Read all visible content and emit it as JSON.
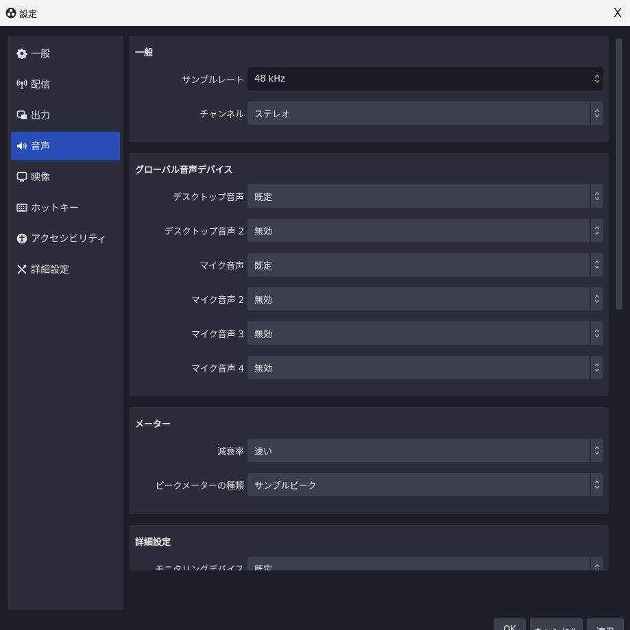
{
  "window": {
    "title": "設定",
    "close_symbol": "X"
  },
  "sidebar": {
    "items": [
      {
        "label": "一般",
        "icon": "gear-icon"
      },
      {
        "label": "配信",
        "icon": "antenna-icon"
      },
      {
        "label": "出力",
        "icon": "output-icon"
      },
      {
        "label": "音声",
        "icon": "speaker-icon",
        "active": true
      },
      {
        "label": "映像",
        "icon": "monitor-icon"
      },
      {
        "label": "ホットキー",
        "icon": "keyboard-icon"
      },
      {
        "label": "アクセシビリティ",
        "icon": "accessibility-icon"
      },
      {
        "label": "詳細設定",
        "icon": "tools-icon"
      }
    ]
  },
  "general": {
    "title": "一般",
    "sample_rate": {
      "label": "サンプルレート",
      "value": "48 kHz"
    },
    "channel": {
      "label": "チャンネル",
      "value": "ステレオ"
    }
  },
  "global_devices": {
    "title": "グローバル音声デバイス",
    "rows": [
      {
        "label": "デスクトップ音声",
        "value": "既定"
      },
      {
        "label": "デスクトップ音声 2",
        "value": "無効"
      },
      {
        "label": "マイク音声",
        "value": "既定"
      },
      {
        "label": "マイク音声 2",
        "value": "無効"
      },
      {
        "label": "マイク音声 3",
        "value": "無効"
      },
      {
        "label": "マイク音声 4",
        "value": "無効"
      }
    ]
  },
  "meters": {
    "title": "メーター",
    "rows": [
      {
        "label": "減衰率",
        "value": "速い"
      },
      {
        "label": "ピークメーターの種類",
        "value": "サンプルピーク"
      }
    ]
  },
  "advanced": {
    "title": "詳細設定",
    "monitoring": {
      "label": "モニタリングデバイス",
      "value": "既定"
    }
  },
  "buttons": {
    "ok": "OK",
    "cancel": "キャンセル",
    "apply": "適用"
  },
  "colors": {
    "accent": "#284cb8",
    "background": "#1e1f29",
    "panel": "#2b2d3a",
    "field": "#3c404d"
  }
}
